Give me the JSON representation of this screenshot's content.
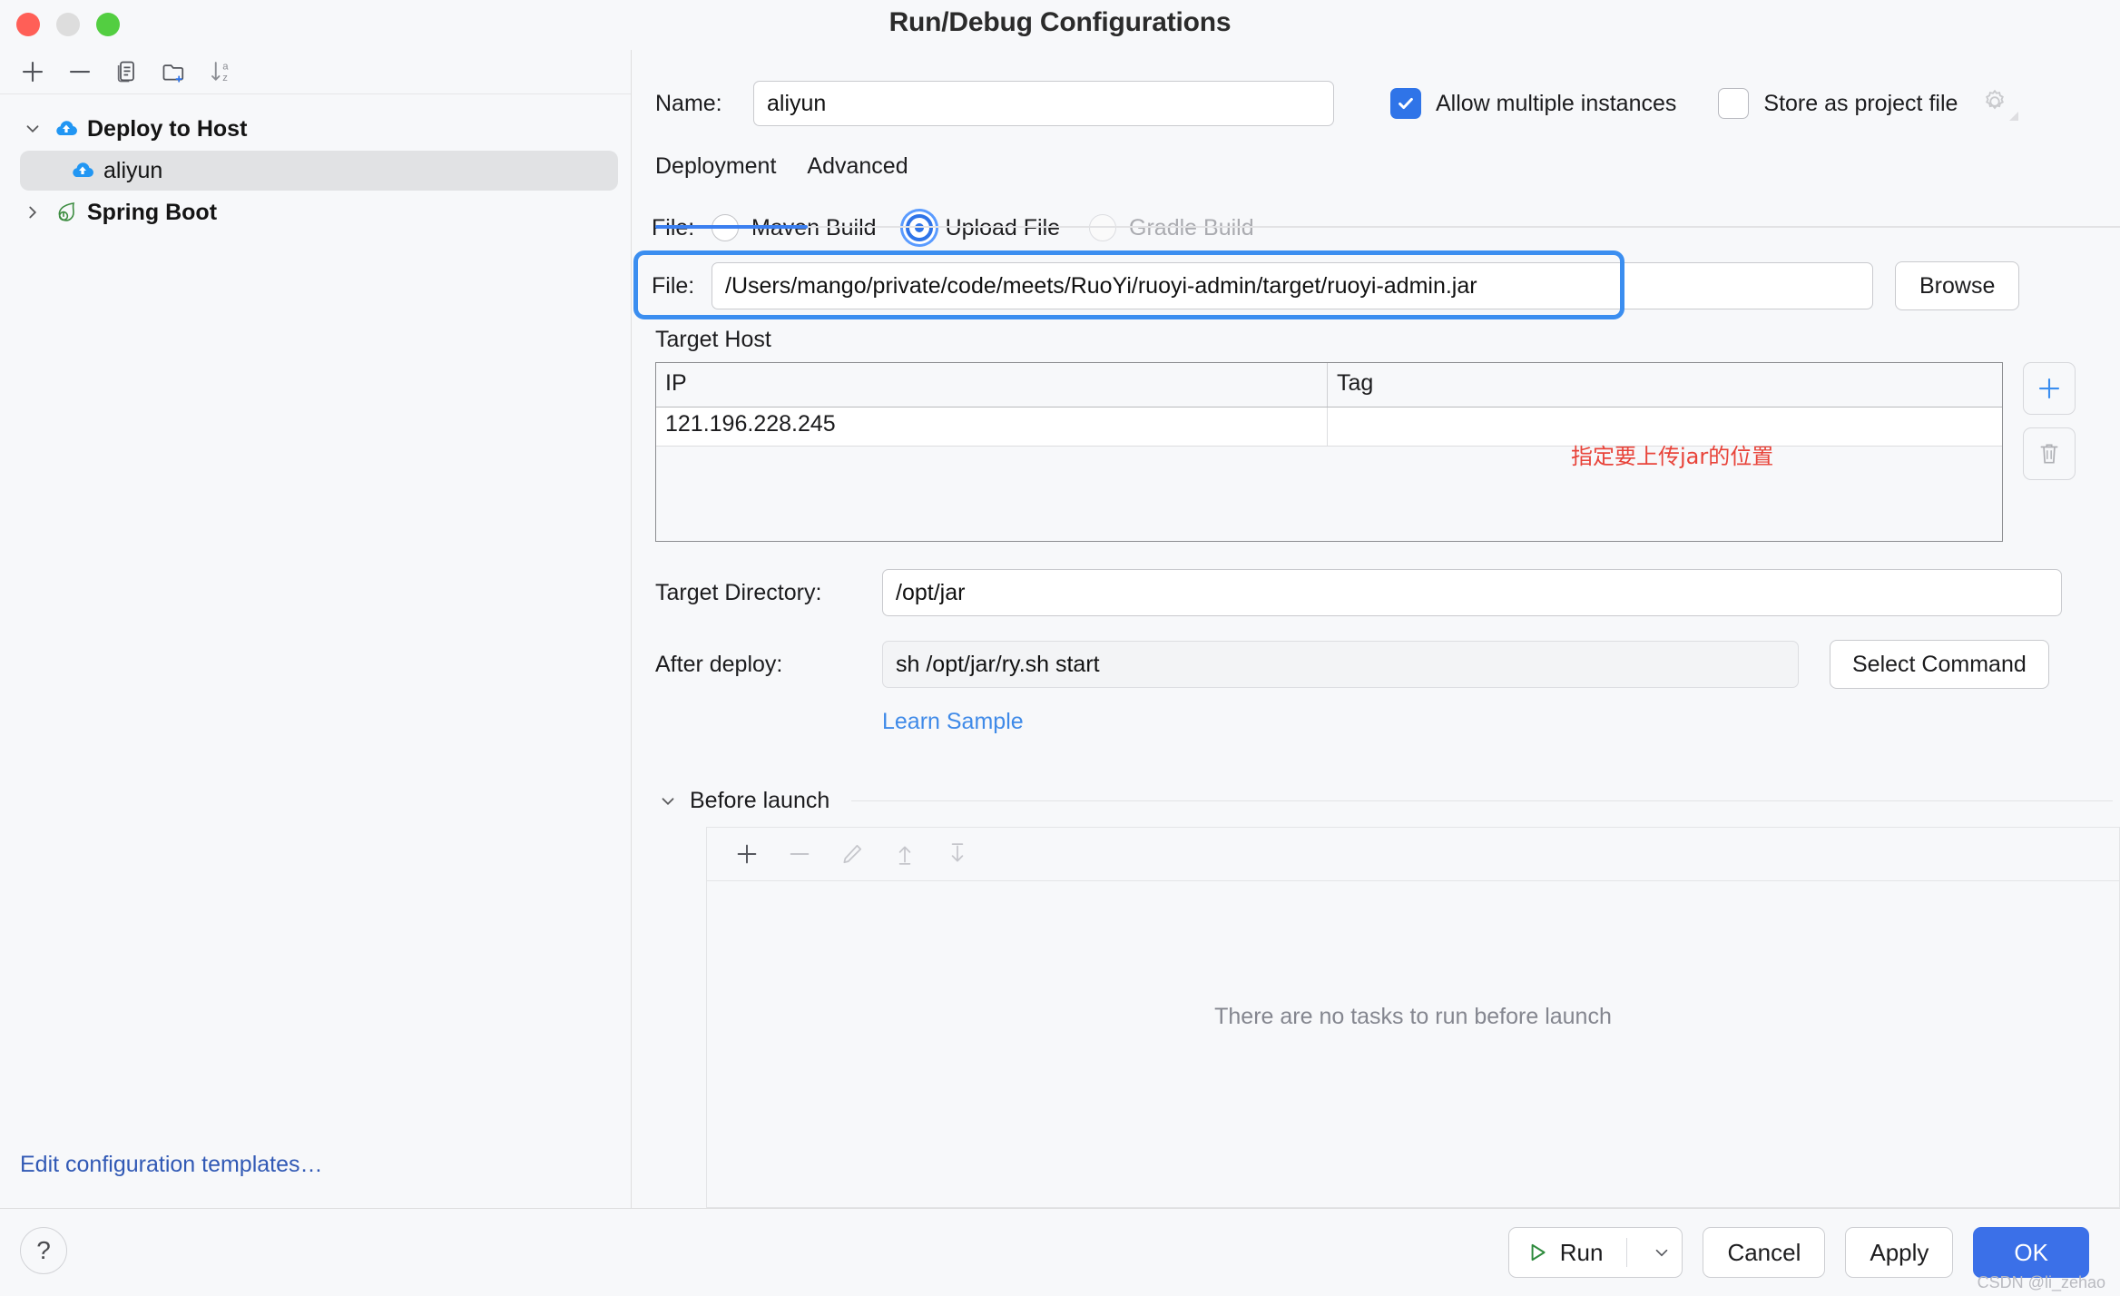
{
  "window": {
    "title": "Run/Debug Configurations",
    "traffic_lights": [
      "close",
      "minimize",
      "zoom"
    ]
  },
  "sidebar": {
    "toolbar": [
      {
        "name": "add-icon",
        "label": "+"
      },
      {
        "name": "remove-icon",
        "label": "−"
      },
      {
        "name": "copy-icon",
        "label": "copy"
      },
      {
        "name": "new-folder-icon",
        "label": "new folder"
      },
      {
        "name": "sort-alphabetically-icon",
        "label": "sort a-z"
      }
    ],
    "tree": [
      {
        "label": "Deploy to Host",
        "icon": "deploy-cloud-icon",
        "expanded": true,
        "selected": false,
        "level": 0
      },
      {
        "label": "aliyun",
        "icon": "deploy-cloud-icon",
        "expanded": null,
        "selected": true,
        "level": 1
      },
      {
        "label": "Spring Boot",
        "icon": "spring-leaf-icon",
        "expanded": false,
        "selected": false,
        "level": 0
      }
    ],
    "edit_templates_link": "Edit configuration templates…"
  },
  "form": {
    "name_label": "Name:",
    "name_value": "aliyun",
    "name_placeholder": "",
    "allow_multiple_instances": {
      "label": "Allow multiple instances",
      "checked": true
    },
    "store_as_project_file": {
      "label": "Store as project file",
      "checked": false,
      "gear_icon": "gear-icon"
    },
    "tabs": [
      {
        "label": "Deployment",
        "active": true
      },
      {
        "label": "Advanced",
        "active": false
      }
    ],
    "file_radio_label": "File:",
    "file_radios": [
      {
        "label": "Maven Build",
        "selected": false,
        "disabled": false
      },
      {
        "label": "Upload File",
        "selected": true,
        "disabled": false
      },
      {
        "label": "Gradle Build",
        "selected": false,
        "disabled": true
      }
    ],
    "file_path_label": "File:",
    "file_path_value": "/Users/mango/private/code/meets/RuoYi/ruoyi-admin/target/ruoyi-admin.jar",
    "browse_label": "Browse",
    "target_host_label": "Target Host",
    "target_host_table": {
      "columns": [
        "IP",
        "Tag"
      ],
      "rows": [
        [
          "121.196.228.245",
          ""
        ]
      ]
    },
    "table_buttons": [
      {
        "name": "add-host-button",
        "icon": "plus-icon"
      },
      {
        "name": "delete-host-button",
        "icon": "trash-icon"
      }
    ],
    "target_directory_label": "Target Directory:",
    "target_directory_value": "/opt/jar",
    "after_deploy_label": "After deploy:",
    "after_deploy_value": "sh /opt/jar/ry.sh start",
    "select_command_label": "Select Command",
    "learn_sample_label": "Learn Sample"
  },
  "annotation": {
    "text": "指定要上传jar的位置",
    "text_color": "#e8443a",
    "box_color": "#3b8ef0"
  },
  "before_launch": {
    "title": "Before launch",
    "expanded": true,
    "toolbar": [
      {
        "name": "add-task-icon",
        "label": "+",
        "disabled": false
      },
      {
        "name": "remove-task-icon",
        "label": "−",
        "disabled": true
      },
      {
        "name": "edit-task-icon",
        "label": "edit",
        "disabled": true
      },
      {
        "name": "move-up-icon",
        "label": "up",
        "disabled": true
      },
      {
        "name": "move-down-icon",
        "label": "down",
        "disabled": true
      }
    ],
    "empty_text": "There are no tasks to run before launch"
  },
  "footer": {
    "help_label": "?",
    "run_label": "Run",
    "run_icon": "play-icon",
    "run_caret_icon": "chevron-down-icon",
    "cancel_label": "Cancel",
    "apply_label": "Apply",
    "ok_label": "OK"
  },
  "watermark": "CSDN @li_zehao",
  "colors": {
    "accent": "#3b70e8",
    "checkbox_on": "#2f74e8",
    "link": "#3159b5",
    "tab_underline": "#3b7ff0",
    "annotation_red": "#e8443a",
    "run_green": "#2e8b3d"
  }
}
